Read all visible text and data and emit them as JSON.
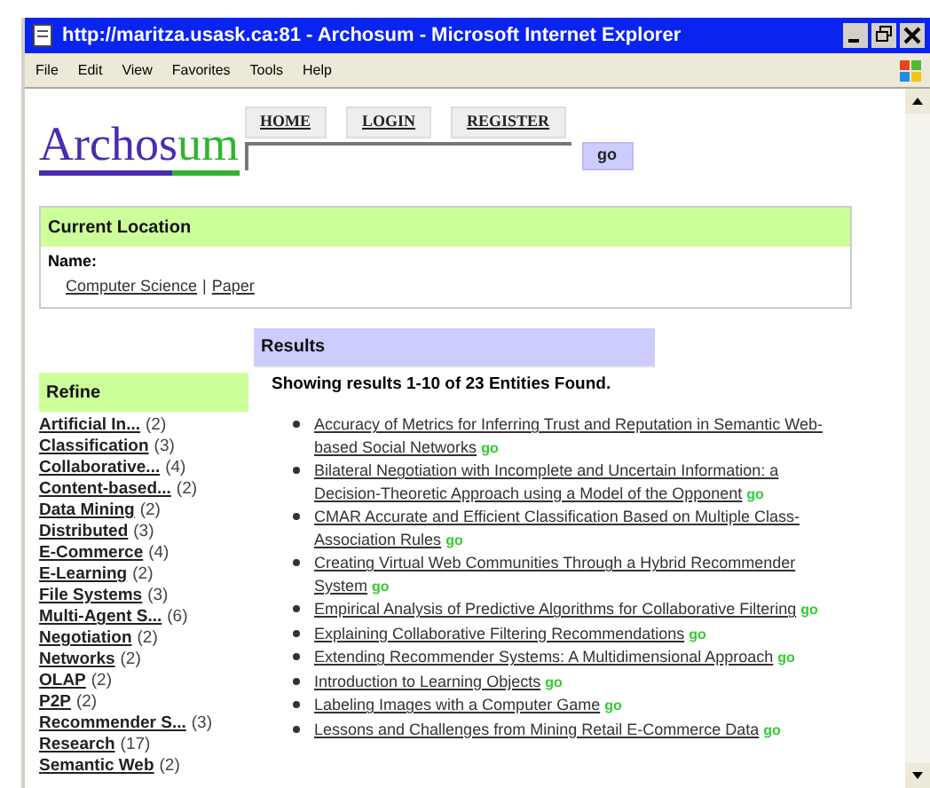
{
  "window": {
    "title": "http://maritza.usask.ca:81 - Archosum - Microsoft Internet Explorer"
  },
  "menu": [
    "File",
    "Edit",
    "View",
    "Favorites",
    "Tools",
    "Help"
  ],
  "logo": {
    "parts": [
      {
        "text": "Archos",
        "color": "#4a2cb0"
      },
      {
        "text": "um",
        "color": "#2fb52f"
      }
    ]
  },
  "nav": [
    "HOME",
    "LOGIN",
    "REGISTER"
  ],
  "search": {
    "button": "go"
  },
  "current_location": {
    "title": "Current Location",
    "name_label": "Name:",
    "path": [
      "Computer Science",
      "Paper"
    ],
    "separator": "|"
  },
  "refine": {
    "title": "Refine",
    "items": [
      {
        "label": "Artificial In...",
        "count": "(2)"
      },
      {
        "label": "Classification",
        "count": "(3)"
      },
      {
        "label": "Collaborative...",
        "count": "(4)"
      },
      {
        "label": "Content-based...",
        "count": "(2)"
      },
      {
        "label": "Data Mining",
        "count": "(2)"
      },
      {
        "label": "Distributed",
        "count": "(3)"
      },
      {
        "label": "E-Commerce",
        "count": "(4)"
      },
      {
        "label": "E-Learning",
        "count": "(2)"
      },
      {
        "label": "File Systems",
        "count": "(3)"
      },
      {
        "label": "Multi-Agent S...",
        "count": "(6)"
      },
      {
        "label": "Negotiation",
        "count": "(2)"
      },
      {
        "label": "Networks",
        "count": "(2)"
      },
      {
        "label": "OLAP",
        "count": "(2)"
      },
      {
        "label": "P2P",
        "count": "(2)"
      },
      {
        "label": "Recommender S...",
        "count": "(3)"
      },
      {
        "label": "Research",
        "count": "(17)"
      },
      {
        "label": "Semantic Web",
        "count": "(2)"
      }
    ]
  },
  "results": {
    "title": "Results",
    "summary": "Showing results 1-10 of 23 Entities Found.",
    "items": [
      {
        "title": "Accuracy of Metrics for Inferring Trust and Reputation in Semantic Web-based Social Networks",
        "go": "go"
      },
      {
        "title": "Bilateral Negotiation with Incomplete and Uncertain Information: a Decision-Theoretic Approach using a Model of the Opponent",
        "go": "go"
      },
      {
        "title": "CMAR Accurate and Efficient Classification Based on Multiple Class-Association Rules",
        "go": "go"
      },
      {
        "title": "Creating Virtual Web Communities Through a Hybrid Recommender System",
        "go": "go"
      },
      {
        "title": "Empirical Analysis of Predictive Algorithms for Collaborative Filtering",
        "go": "go"
      },
      {
        "title": "Explaining Collaborative Filtering Recommendations",
        "go": "go"
      },
      {
        "title": "Extending Recommender Systems: A Multidimensional Approach",
        "go": "go"
      },
      {
        "title": "Introduction to Learning Objects",
        "go": "go"
      },
      {
        "title": "Labeling Images with a Computer Game",
        "go": "go"
      },
      {
        "title": "Lessons and Challenges from Mining Retail E-Commerce Data",
        "go": "go"
      }
    ]
  }
}
